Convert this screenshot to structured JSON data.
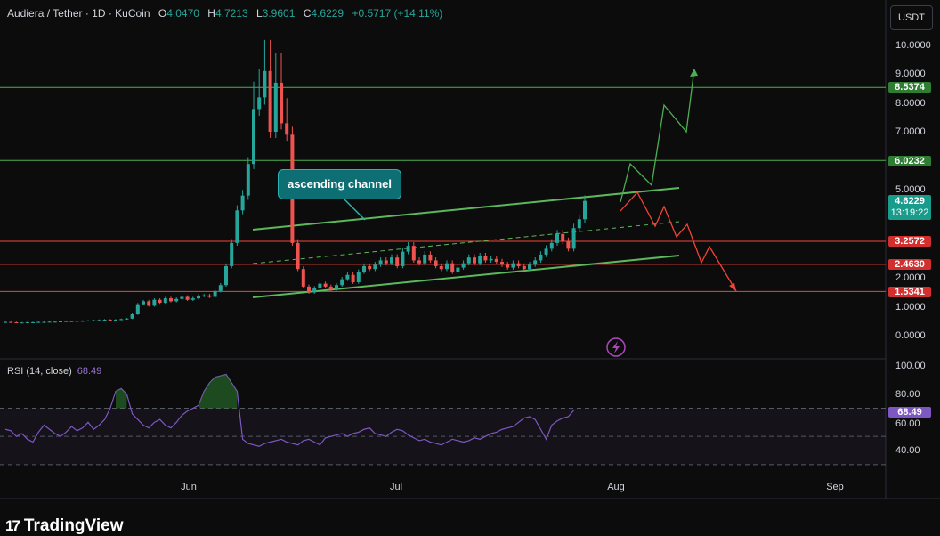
{
  "header": {
    "symbol": "Audiera / Tether · 1D · KuCoin",
    "open_label": "O",
    "open": "4.0470",
    "high_label": "H",
    "high": "4.7213",
    "low_label": "L",
    "low": "3.9601",
    "close_label": "C",
    "close": "4.6229",
    "change": "+0.5717 (+14.11%)"
  },
  "currency_button": "USDT",
  "price_axis_ticks": [
    "10.0000",
    "9.0000",
    "8.0000",
    "7.0000",
    "5.0000",
    "2.0000",
    "1.0000",
    "0.0000"
  ],
  "level_tags": [
    {
      "label": "8.5374",
      "value": 8.5374,
      "color": "#2e7d32"
    },
    {
      "label": "6.0232",
      "value": 6.0232,
      "color": "#2e7d32"
    },
    {
      "label": "3.2572",
      "value": 3.2572,
      "color": "#d32f2f"
    },
    {
      "label": "2.4630",
      "value": 2.463,
      "color": "#d32f2f"
    },
    {
      "label": "1.5341",
      "value": 1.5341,
      "color": "#d32f2f"
    }
  ],
  "current_price": {
    "value": "4.6229",
    "countdown": "13:19:22"
  },
  "annotation": "ascending channel",
  "rsi": {
    "label": "RSI (14, close)",
    "value": "68.49",
    "ticks": [
      "100.00",
      "80.00",
      "60.00",
      "40.00"
    ],
    "upper_band": 70,
    "lower_band": 30
  },
  "time_axis": [
    "Jun",
    "Jul",
    "Aug",
    "Sep"
  ],
  "brand": "TradingView",
  "colors": {
    "bull": "#26a69a",
    "bear": "#ef5350",
    "green_level": "#4caf50",
    "red_level": "#f44336",
    "rsi_line": "#7e57c2",
    "accent": "#1a9c8c"
  },
  "chart_data": {
    "type": "candlestick",
    "closes": [
      0.48,
      0.47,
      0.46,
      0.46,
      0.47,
      0.47,
      0.48,
      0.48,
      0.49,
      0.49,
      0.5,
      0.51,
      0.51,
      0.52,
      0.52,
      0.53,
      0.54,
      0.55,
      0.56,
      0.55,
      0.56,
      0.58,
      0.6,
      0.75,
      1.1,
      1.2,
      1.05,
      1.25,
      1.15,
      1.3,
      1.2,
      1.28,
      1.35,
      1.25,
      1.3,
      1.38,
      1.4,
      1.35,
      1.55,
      1.75,
      2.4,
      3.2,
      4.3,
      4.8,
      5.9,
      7.8,
      8.2,
      9.1,
      7.0,
      8.7,
      7.3,
      6.9,
      3.2,
      2.3,
      1.7,
      1.5,
      1.65,
      1.8,
      1.7,
      1.6,
      1.75,
      1.95,
      2.1,
      1.85,
      2.2,
      2.4,
      2.3,
      2.45,
      2.6,
      2.5,
      2.7,
      2.4,
      2.9,
      3.1,
      2.6,
      2.5,
      2.8,
      2.6,
      2.4,
      2.3,
      2.5,
      2.2,
      2.35,
      2.5,
      2.7,
      2.5,
      2.75,
      2.6,
      2.65,
      2.55,
      2.45,
      2.35,
      2.5,
      2.4,
      2.3,
      2.45,
      2.6,
      2.8,
      3.0,
      3.2,
      3.5,
      3.25,
      3.0,
      3.7,
      4.0,
      4.62
    ],
    "rsi_values": [
      55,
      54,
      50,
      52,
      48,
      46,
      53,
      58,
      55,
      52,
      50,
      53,
      57,
      54,
      56,
      60,
      55,
      58,
      62,
      70,
      82,
      84,
      80,
      66,
      62,
      58,
      56,
      60,
      62,
      58,
      56,
      60,
      65,
      68,
      70,
      72,
      82,
      88,
      92,
      93,
      94,
      88,
      82,
      48,
      45,
      44,
      43,
      45,
      46,
      47,
      48,
      46,
      45,
      44,
      47,
      48,
      46,
      44,
      49,
      50,
      51,
      52,
      50,
      52,
      53,
      55,
      56,
      52,
      51,
      50,
      53,
      55,
      54,
      51,
      49,
      47,
      48,
      46,
      45,
      44,
      46,
      48,
      47,
      46,
      47,
      49,
      48,
      50,
      52,
      53,
      55,
      56,
      57,
      60,
      63,
      64,
      62,
      55,
      48,
      58,
      61,
      63,
      64,
      68.5
    ]
  }
}
